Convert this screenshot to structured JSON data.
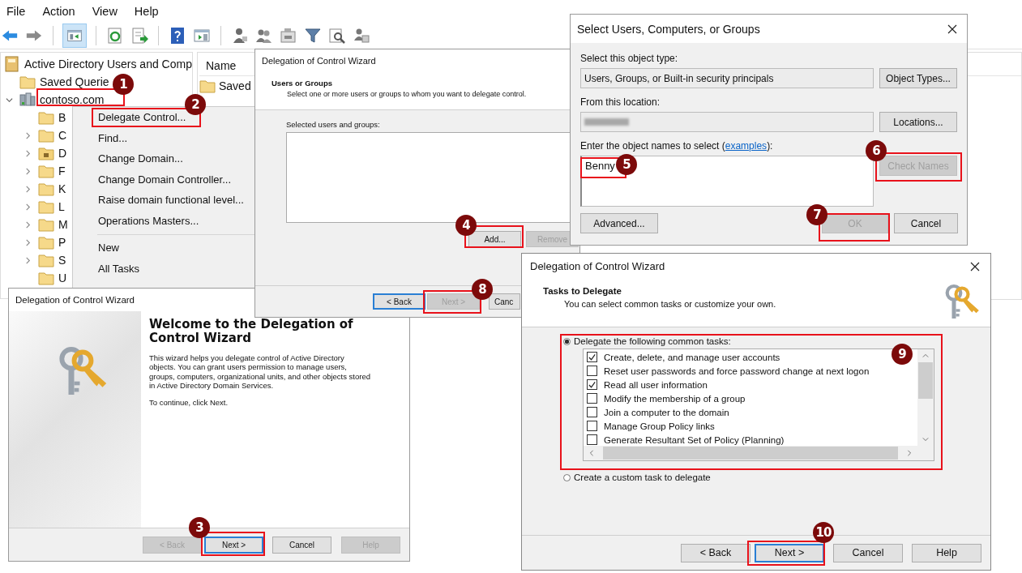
{
  "menu_bar": [
    "File",
    "Action",
    "View",
    "Help"
  ],
  "toolbar": {
    "console_tree_pressed": true
  },
  "console_tree": {
    "title": "Active Directory Users and Comp",
    "items": [
      {
        "label": "Saved Querie",
        "kind": "folder",
        "expandable": false
      },
      {
        "label": "contoso.com",
        "kind": "domain",
        "expandable": true,
        "expanded": true,
        "children": [
          {
            "label": "B",
            "kind": "folder",
            "expandable": false
          },
          {
            "label": "C",
            "kind": "folder",
            "expandable": true,
            "expanded": false
          },
          {
            "label": "D",
            "kind": "special",
            "expandable": true,
            "expanded": false
          },
          {
            "label": "F",
            "kind": "folder",
            "expandable": true,
            "expanded": false
          },
          {
            "label": "K",
            "kind": "folder",
            "expandable": true,
            "expanded": false
          },
          {
            "label": "L",
            "kind": "folder",
            "expandable": true,
            "expanded": false
          },
          {
            "label": "M",
            "kind": "folder",
            "expandable": true,
            "expanded": false
          },
          {
            "label": "P",
            "kind": "folder",
            "expandable": true,
            "expanded": false
          },
          {
            "label": "S",
            "kind": "folder",
            "expandable": true,
            "expanded": false
          },
          {
            "label": "U",
            "kind": "folder",
            "expandable": false
          }
        ]
      }
    ]
  },
  "details_pane": {
    "columns": [
      "Name"
    ],
    "rows": [
      {
        "label": "Saved",
        "kind": "folder"
      }
    ]
  },
  "context_menu": [
    {
      "kind": "item",
      "label": "Delegate Control..."
    },
    {
      "kind": "item",
      "label": "Find..."
    },
    {
      "kind": "item",
      "label": "Change Domain..."
    },
    {
      "kind": "item",
      "label": "Change Domain Controller..."
    },
    {
      "kind": "item",
      "label": "Raise domain functional level..."
    },
    {
      "kind": "item",
      "label": "Operations Masters..."
    },
    {
      "kind": "separator"
    },
    {
      "kind": "item",
      "label": "New"
    },
    {
      "kind": "item",
      "label": "All Tasks"
    }
  ],
  "users_wizard": {
    "title": "Delegation of Control Wizard",
    "heading": "Users or Groups",
    "subtitle": "Select one or more users or groups to whom you want to delegate control.",
    "list_label": "Selected users and groups:",
    "list_buttons": [
      {
        "label": "Add...",
        "disabled": false
      },
      {
        "label": "Remove",
        "disabled": true
      }
    ],
    "buttons": [
      {
        "label": "< Back",
        "disabled": false,
        "default": true
      },
      {
        "label": "Next >",
        "disabled": true,
        "default": false
      },
      {
        "label": "Canc",
        "disabled": false,
        "default": false
      }
    ]
  },
  "select_dialog": {
    "title": "Select Users, Computers, or Groups",
    "object_type_label": "Select this object type:",
    "object_type": "Users, Groups, or Built-in security principals",
    "object_types_button": "Object Types...",
    "location_label": "From this location:",
    "location_redacted": true,
    "locations_button": "Locations...",
    "names_label_start": "Enter the object names to select (",
    "names_link": "examples",
    "names_label_end": "):",
    "names_value": "Benny",
    "check_names": {
      "label": "Check Names",
      "disabled": true
    },
    "advanced_button": "Advanced...",
    "ok": {
      "label": "OK",
      "disabled": true
    },
    "cancel": {
      "label": "Cancel",
      "disabled": false
    }
  },
  "welcome_wizard": {
    "title": "Delegation of Control Wizard",
    "heading": "Welcome to the Delegation of Control Wizard",
    "body": "This wizard helps you delegate control of Active Directory objects. You can grant users permission to manage users, groups, computers, organizational units, and other objects stored in Active Directory Domain Services.",
    "continue_hint": "To continue, click Next.",
    "buttons": [
      {
        "label": "< Back",
        "disabled": true,
        "default": false
      },
      {
        "label": "Next >",
        "disabled": false,
        "default": true
      },
      {
        "label": "Cancel",
        "disabled": false,
        "default": false
      },
      {
        "label": "Help",
        "disabled": true,
        "default": false
      }
    ]
  },
  "tasks_wizard": {
    "title": "Delegation of Control Wizard",
    "heading": "Tasks to Delegate",
    "subtitle": "You can select common tasks or customize your own.",
    "options": [
      {
        "label": "Delegate the following common tasks:",
        "selected": true
      },
      {
        "label": "Create a custom task to delegate",
        "selected": false
      }
    ],
    "tasks": [
      {
        "label": "Create, delete, and manage user accounts",
        "checked": true
      },
      {
        "label": "Reset user passwords and force password change at next logon",
        "checked": false
      },
      {
        "label": "Read all user information",
        "checked": true
      },
      {
        "label": "Modify the membership of a group",
        "checked": false
      },
      {
        "label": "Join a computer to the domain",
        "checked": false
      },
      {
        "label": "Manage Group Policy links",
        "checked": false
      },
      {
        "label": "Generate Resultant Set of Policy (Planning)",
        "checked": false
      }
    ],
    "buttons": [
      {
        "label": "< Back",
        "disabled": false,
        "default": false
      },
      {
        "label": "Next >",
        "disabled": false,
        "default": true
      },
      {
        "label": "Cancel",
        "disabled": false,
        "default": false
      },
      {
        "label": "Help",
        "disabled": false,
        "default": false
      }
    ]
  },
  "annotations": [
    {
      "number": "1"
    },
    {
      "number": "2"
    },
    {
      "number": "3"
    },
    {
      "number": "4"
    },
    {
      "number": "5"
    },
    {
      "number": "6"
    },
    {
      "number": "7"
    },
    {
      "number": "8"
    },
    {
      "number": "9"
    },
    {
      "number": "10"
    }
  ]
}
